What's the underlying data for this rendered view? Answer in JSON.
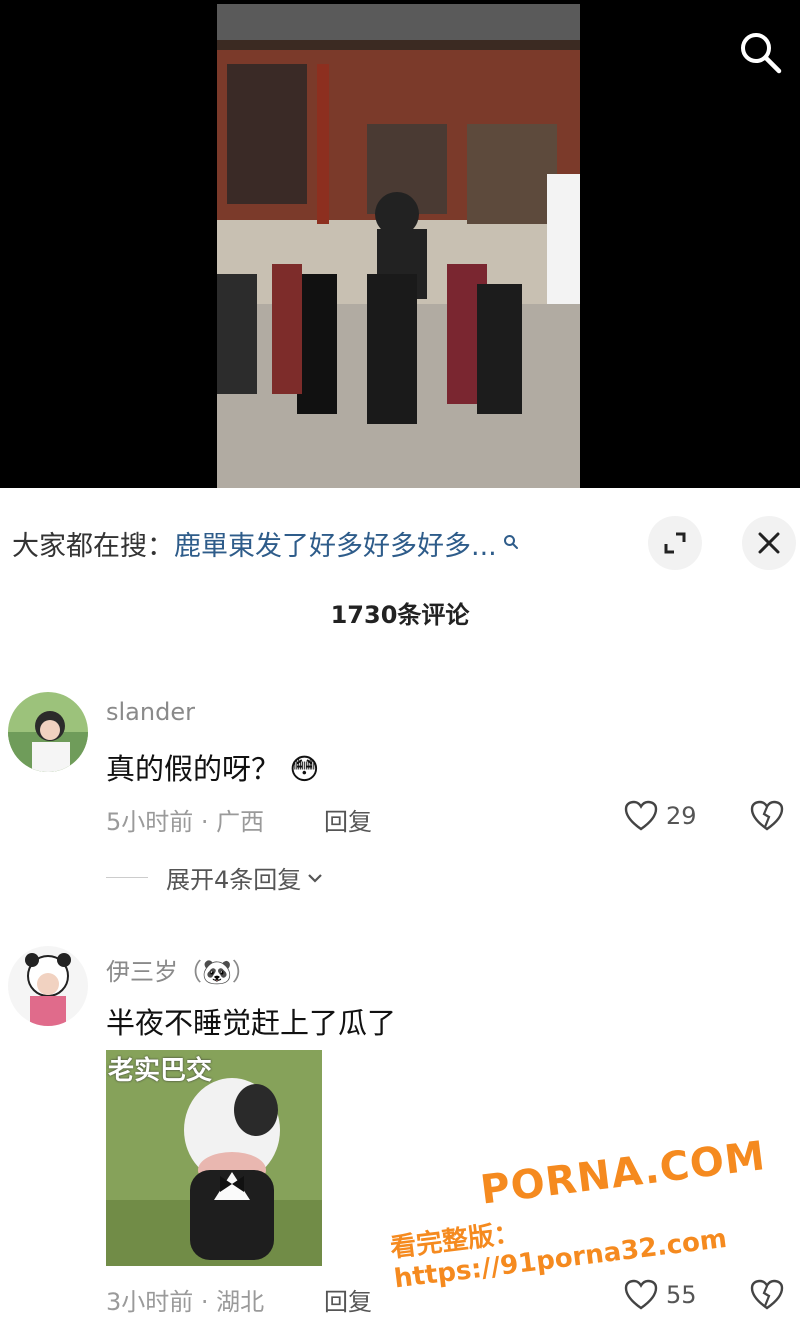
{
  "trending": {
    "prefix": "大家都在搜：",
    "query": "鹿單東发了好多好多好多..."
  },
  "comment_count_label": "1730条评论",
  "comments": [
    {
      "username": "slander",
      "text": "真的假的呀？",
      "emoji": "😳",
      "meta": "5小时前 · 广西",
      "reply_label": "回复",
      "likes": "29",
      "expand_label": "展开4条回复"
    },
    {
      "username": "伊三岁（🐼）",
      "text": "半夜不睡觉赶上了瓜了",
      "sticker_text": "老实巴交",
      "meta": "3小时前 · 湖北",
      "reply_label": "回复",
      "likes": "55"
    }
  ],
  "watermark": {
    "brand": "PORNA.COM",
    "line": "看完整版：https://91porna32.com"
  },
  "icons": {
    "search": "search-icon",
    "collapse": "collapse-icon",
    "close": "close-icon",
    "like": "heart-icon",
    "dislike": "broken-heart-icon",
    "chevron": "chevron-down-icon"
  },
  "colors": {
    "query": "#2e5c8a",
    "watermark": "#f58a1f"
  }
}
